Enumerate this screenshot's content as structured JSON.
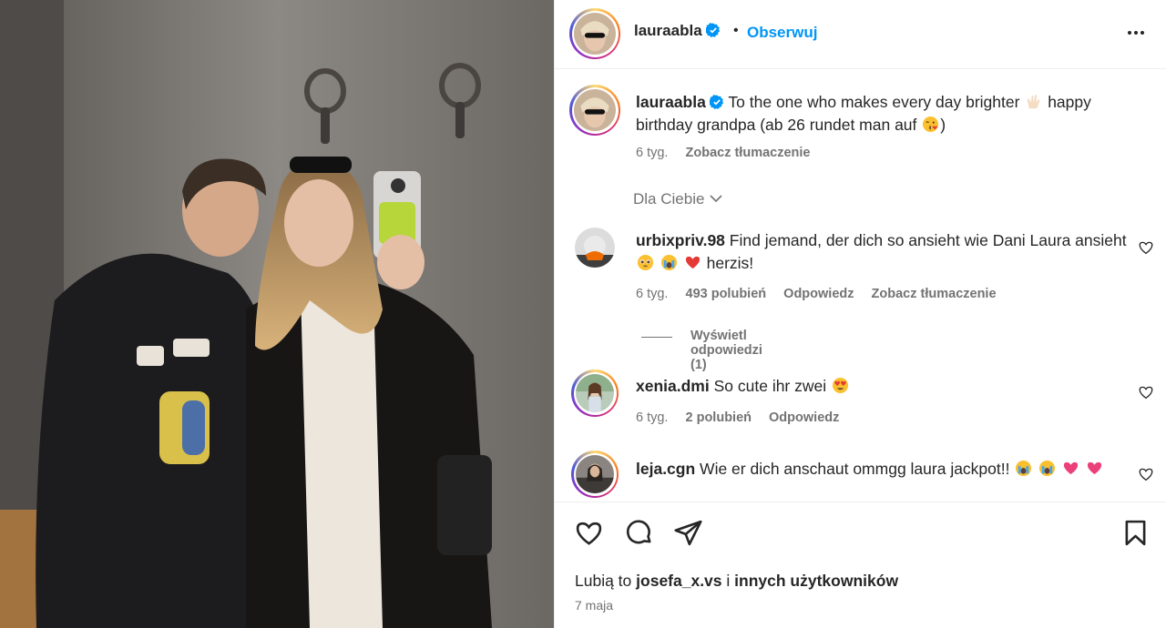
{
  "post": {
    "author": "lauraabla",
    "follow_label": "Obserwuj",
    "separator": "•",
    "more_icon": "more-options-icon"
  },
  "caption": {
    "username": "lauraabla",
    "text_part1": "To the one who makes every day brighter",
    "text_part2": "happy birthday grandpa (ab 26 rundet man auf",
    "text_part3": ")",
    "emojis": [
      "raising-hands",
      "kissing-face"
    ],
    "time": "6 tyg.",
    "translate": "Zobacz tłumaczenie"
  },
  "section": {
    "for_you": "Dla Ciebie"
  },
  "comments": [
    {
      "username": "urbixpriv.98",
      "text": "Find jemand, der dich so ansieht wie Dani Laura ansieht",
      "text_end": "herzis!",
      "emojis": [
        "pleading-face",
        "crying-face",
        "red-heart"
      ],
      "time": "6 tyg.",
      "likes": "493 polubień",
      "reply": "Odpowiedz",
      "translate": "Zobacz tłumaczenie",
      "view_replies": "Wyświetl odpowiedzi (1)"
    },
    {
      "username": "xenia.dmi",
      "text": "So cute ihr zwei",
      "emojis": [
        "heart-eyes"
      ],
      "time": "6 tyg.",
      "likes": "2 polubień",
      "reply": "Odpowiedz"
    },
    {
      "username": "leja.cgn",
      "text": "Wie er dich anschaut ommgg laura jackpot!!",
      "emojis": [
        "crying-face",
        "crying-face",
        "pink-heart",
        "pink-heart"
      ]
    }
  ],
  "footer": {
    "likes_prefix": "Lubią to",
    "likes_user": "josefa_x.vs",
    "likes_middle": "i",
    "likes_others": "innych użytkowników",
    "date": "7 maja"
  },
  "colors": {
    "link": "#0095f6",
    "muted": "#737373",
    "text": "#262626",
    "verified": "#0095f6"
  }
}
